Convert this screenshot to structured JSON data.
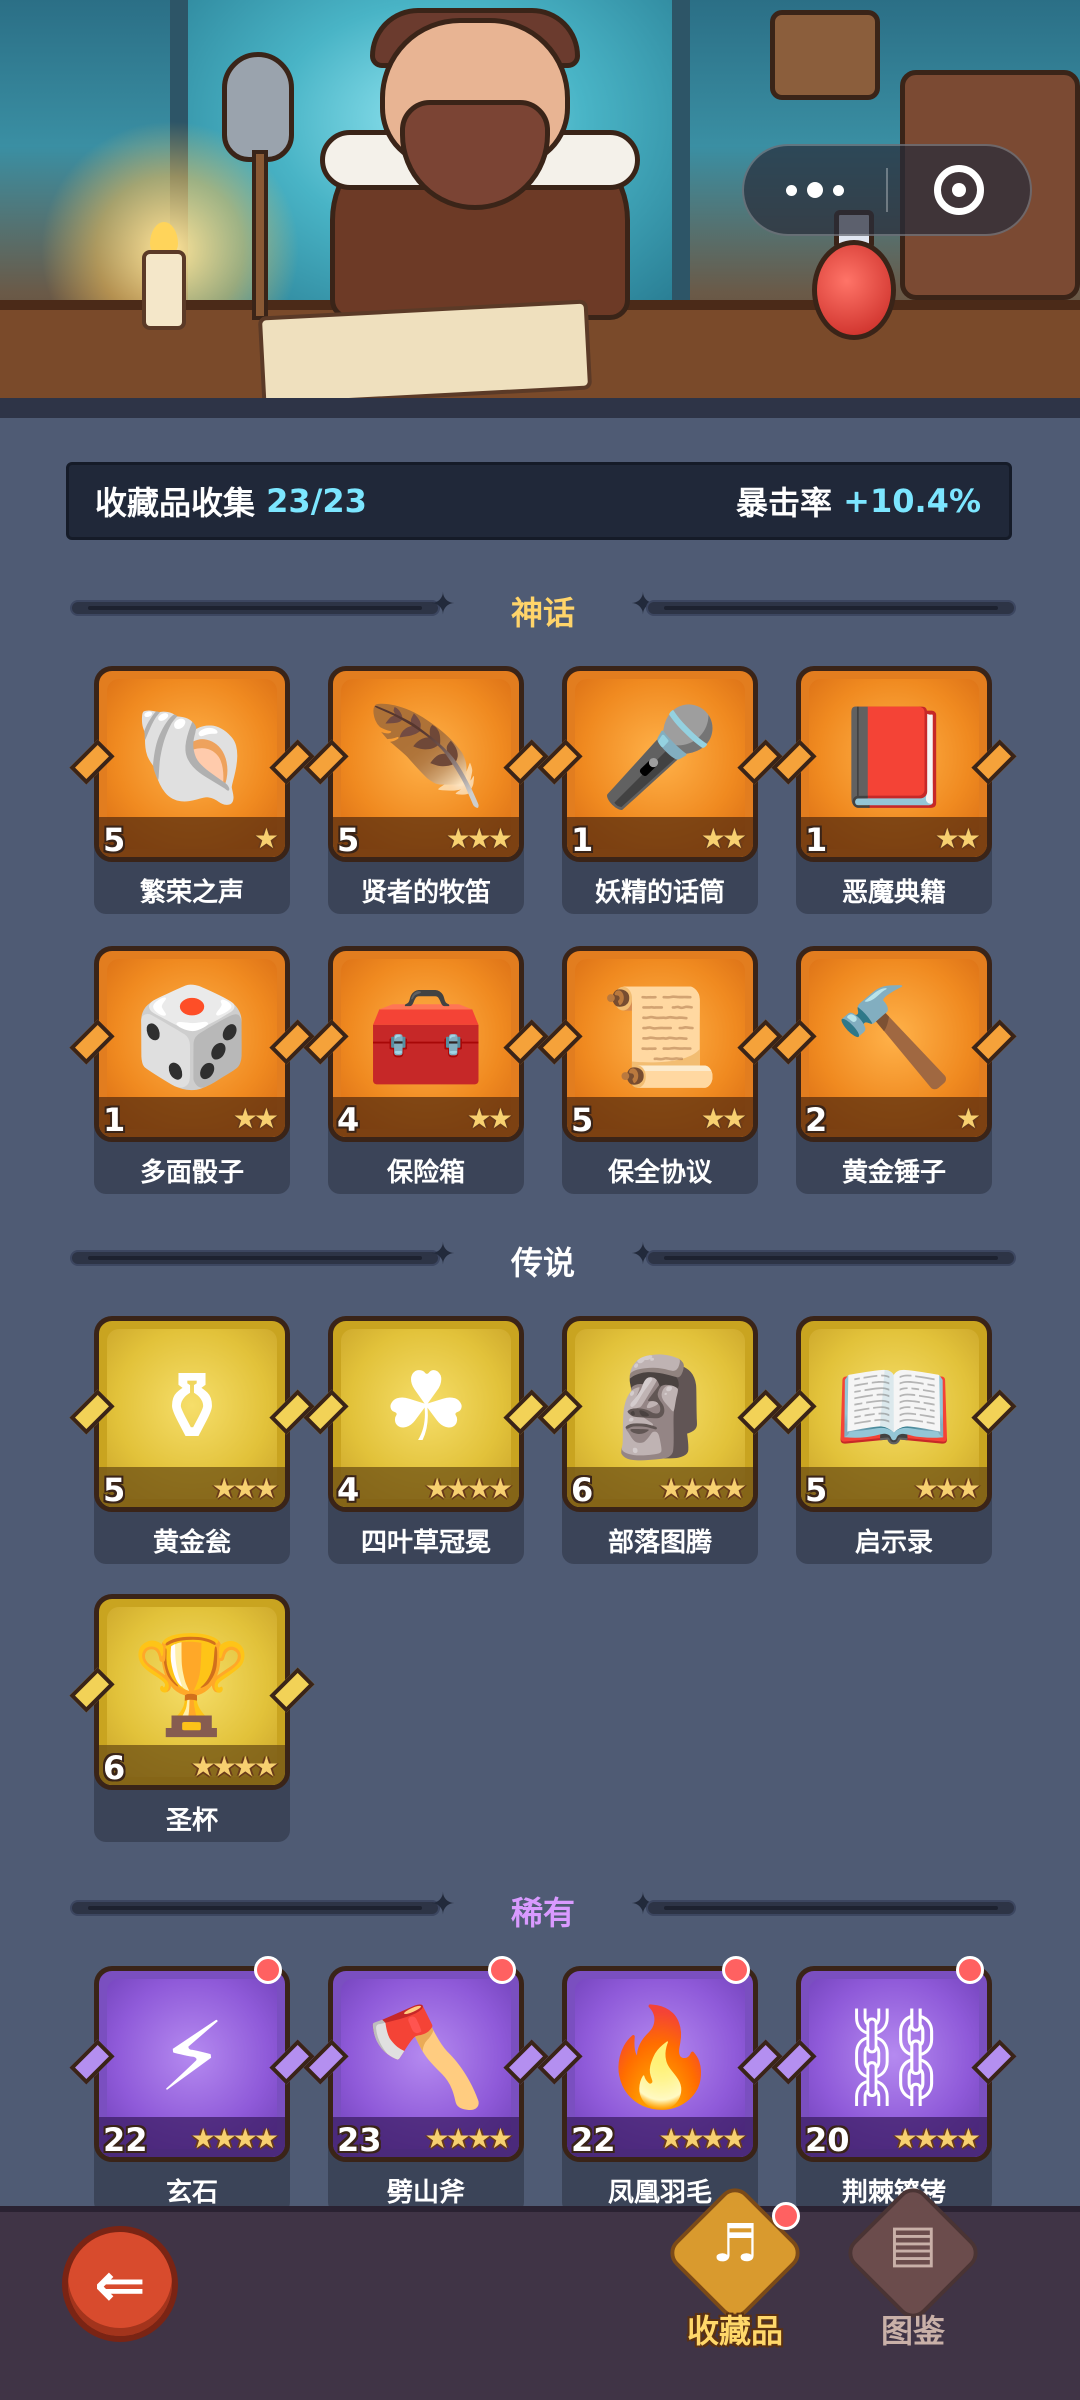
{
  "header": {
    "menu_icon": "more-dots-icon",
    "close_icon": "target-close-icon"
  },
  "summary": {
    "label": "收藏品收集",
    "progress": "23/23",
    "crit_label": "暴击率",
    "crit_value": "+10.4%"
  },
  "sections": {
    "mythic": "神话",
    "legendary": "传说",
    "rare": "稀有"
  },
  "mythic_items": [
    {
      "name": "繁荣之声",
      "count": "5",
      "stars": "★",
      "icon": "horn-shell-icon"
    },
    {
      "name": "贤者的牧笛",
      "count": "5",
      "stars": "★★★",
      "icon": "flute-icon"
    },
    {
      "name": "妖精的话筒",
      "count": "1",
      "stars": "★★",
      "icon": "fairy-mic-icon"
    },
    {
      "name": "恶魔典籍",
      "count": "1",
      "stars": "★★",
      "icon": "demon-book-icon"
    },
    {
      "name": "多面骰子",
      "count": "1",
      "stars": "★★",
      "icon": "dice-icon"
    },
    {
      "name": "保险箱",
      "count": "4",
      "stars": "★★",
      "icon": "treasure-chest-icon"
    },
    {
      "name": "保全协议",
      "count": "5",
      "stars": "★★",
      "icon": "scroll-icon"
    },
    {
      "name": "黄金锤子",
      "count": "2",
      "stars": "★",
      "icon": "hammer-icon"
    }
  ],
  "legendary_items": [
    {
      "name": "黄金瓮",
      "count": "5",
      "stars": "★★★",
      "icon": "urn-icon"
    },
    {
      "name": "四叶草冠冕",
      "count": "4",
      "stars": "★★★★",
      "icon": "clover-crown-icon"
    },
    {
      "name": "部落图腾",
      "count": "6",
      "stars": "★★★★",
      "icon": "totem-icon"
    },
    {
      "name": "启示录",
      "count": "5",
      "stars": "★★★",
      "icon": "open-book-icon"
    },
    {
      "name": "圣杯",
      "count": "6",
      "stars": "★★★★",
      "icon": "grail-icon"
    }
  ],
  "rare_items": [
    {
      "name": "玄石",
      "count": "22",
      "stars": "★★★★",
      "icon": "rune-stone-icon"
    },
    {
      "name": "劈山斧",
      "count": "23",
      "stars": "★★★★",
      "icon": "axe-icon"
    },
    {
      "name": "凤凰羽毛",
      "count": "22",
      "stars": "★★★★",
      "icon": "phoenix-feather-icon"
    },
    {
      "name": "荆棘镣铐",
      "count": "20",
      "stars": "★★★★",
      "icon": "thorn-shackle-icon"
    }
  ],
  "nav": {
    "back_icon": "back-arrow-icon",
    "collect_label": "收藏品",
    "codex_label": "图鉴"
  }
}
